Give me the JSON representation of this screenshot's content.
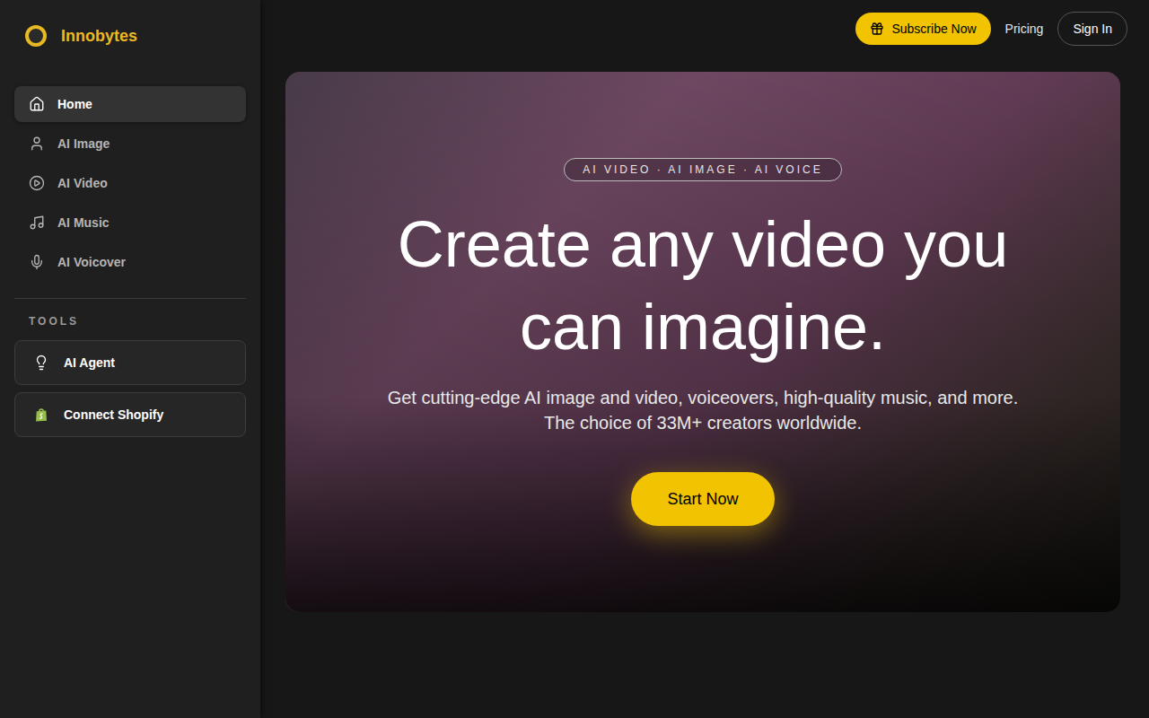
{
  "sidebar": {
    "logo": {
      "text": "Innobytes"
    },
    "items": [
      {
        "label": "Home",
        "icon": "home",
        "selected": true
      },
      {
        "label": "AI Image",
        "icon": "user",
        "selected": false
      },
      {
        "label": "AI Video",
        "icon": "play",
        "selected": false
      },
      {
        "label": "AI Music",
        "icon": "music",
        "selected": false
      },
      {
        "label": "AI Voicover",
        "icon": "mic",
        "selected": false
      }
    ],
    "tools_label": "TOOLS",
    "tools": [
      {
        "label": "AI Agent",
        "icon": "bulb"
      },
      {
        "label": "Connect Shopify",
        "icon": "shopify"
      }
    ]
  },
  "header": {
    "subscribe": "Subscribe Now",
    "pricing": "Pricing",
    "sign_in": "Sign In"
  },
  "hero": {
    "badge": "AI VIDEO · AI IMAGE · AI VOICE",
    "title": "Create any video you can imagine.",
    "subtitle": [
      "Get cutting-edge AI image and video, voiceovers, high-quality music, and more.",
      "The choice of 33M+ creators worldwide."
    ],
    "cta": "Start Now"
  }
}
